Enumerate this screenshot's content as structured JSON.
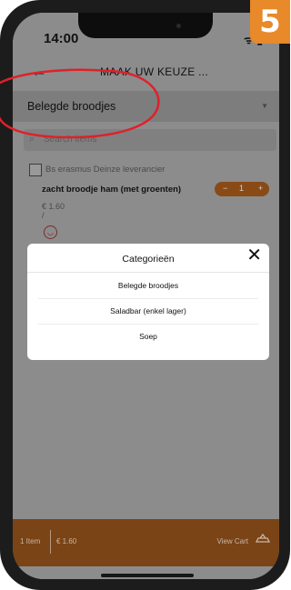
{
  "status_bar": {
    "time": "14:00",
    "icons": "ᯤ ▮"
  },
  "header": {
    "back_icon": "arrow-left",
    "title": "MAAK UW KEUZE ..."
  },
  "category_dropdown": {
    "selected": "Belegde broodjes",
    "caret": "▼"
  },
  "search": {
    "placeholder": "Search items"
  },
  "supplier": {
    "name": "Bs erasmus Deinze leverancier"
  },
  "item": {
    "name": "zacht broodje ham (met groenten)",
    "price": "€ 1.60",
    "note": "/",
    "stepper": {
      "minus": "−",
      "quantity": "1",
      "plus": "+"
    }
  },
  "modal": {
    "title": "Categorieën",
    "close_icon": "✕",
    "categories": [
      "Belegde broodjes",
      "Saladbar (enkel lager)",
      "Soep"
    ]
  },
  "cart_bar": {
    "count": "1 Item",
    "total": "€ 1.60",
    "view_label": "View Cart"
  },
  "step_badge": {
    "number": "5"
  },
  "colors": {
    "overlay_gray": "#8c8c8c",
    "accent_brown": "#7a4416",
    "badge_orange": "#e8892a",
    "annotation_red": "#e0202a"
  }
}
